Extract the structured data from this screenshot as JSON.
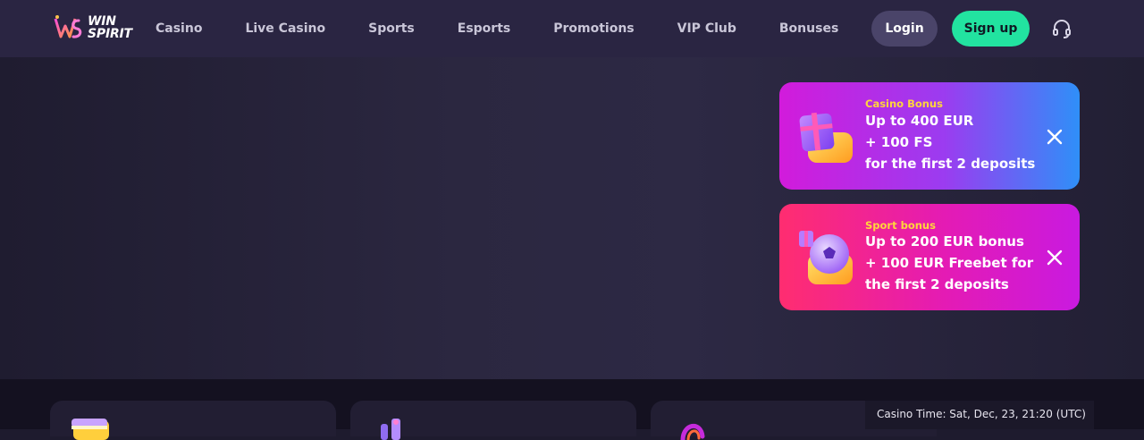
{
  "brand": {
    "name_line1": "WIN",
    "name_line2": "SPIRIT"
  },
  "nav": {
    "items": [
      {
        "label": "Casino"
      },
      {
        "label": "Live Casino"
      },
      {
        "label": "Sports"
      },
      {
        "label": "Esports"
      },
      {
        "label": "Promotions"
      },
      {
        "label": "VIP Club"
      },
      {
        "label": "Bonuses"
      }
    ]
  },
  "auth": {
    "login_label": "Login",
    "signup_label": "Sign up"
  },
  "icons": {
    "support": "headset-icon",
    "close": "close-icon"
  },
  "bonuses": [
    {
      "tag": "Casino Bonus",
      "lines": [
        "Up to 400 EUR",
        "+ 100 FS",
        "for the first 2 deposits"
      ],
      "icon": "gift-box-icon"
    },
    {
      "tag": "Sport bonus",
      "lines": [
        "Up to 200 EUR bonus",
        "+ 100 EUR Freebet for",
        "the first 2 deposits"
      ],
      "icon": "soccer-ball-icon"
    }
  ],
  "footer": {
    "casino_time": "Casino Time: Sat, Dec, 23, 21:20 (UTC)"
  },
  "colors": {
    "accent_green": "#22e3a0",
    "tag_yellow": "#ffd53c",
    "header_bg": "#2a2542"
  }
}
